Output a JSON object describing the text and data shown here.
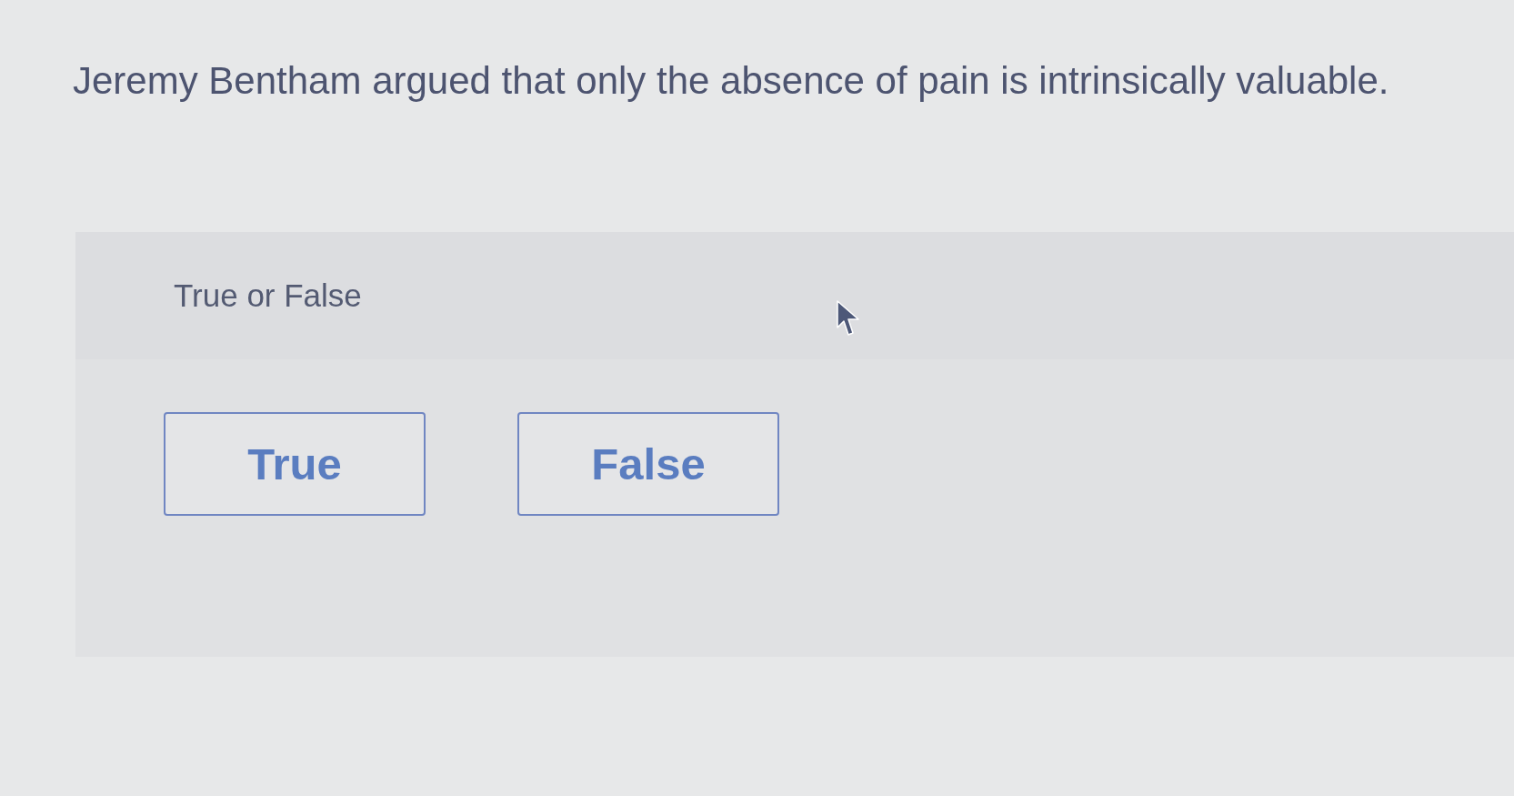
{
  "question": "Jeremy Bentham argued that only the absence of pain is intrinsically valuable.",
  "prompt": "True or False",
  "options": [
    {
      "label": "True",
      "selected": false
    },
    {
      "label": "False",
      "selected": false
    }
  ]
}
